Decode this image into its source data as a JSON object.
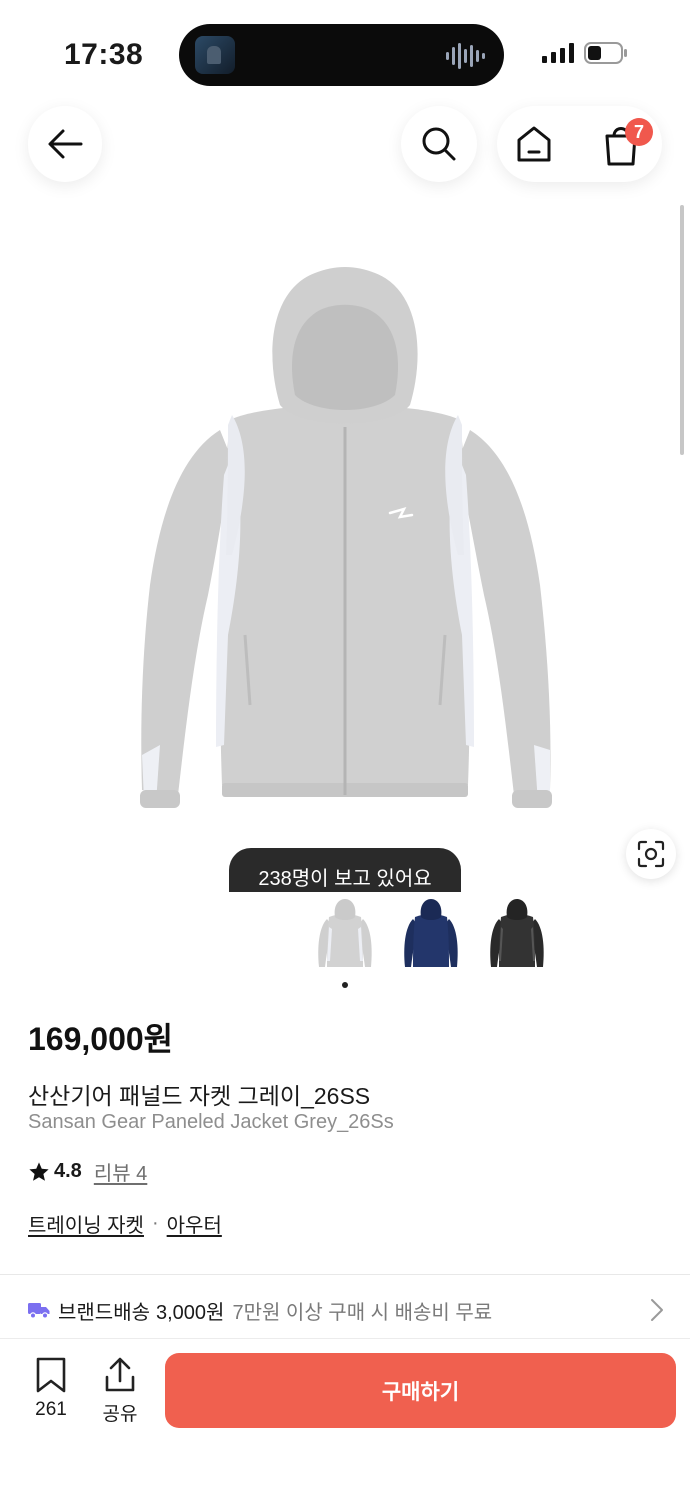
{
  "status_bar": {
    "time": "17:38",
    "signal_icon": "signal-bars-icon",
    "battery_icon": "battery-low-icon"
  },
  "nav": {
    "back_icon": "arrow-left-icon",
    "search_icon": "search-icon",
    "home_icon": "home-icon",
    "cart_icon": "shopping-bag-icon",
    "cart_count": "7"
  },
  "gallery": {
    "viewers_text": "238명이 보고 있어요",
    "visual_search_icon": "camera-scan-icon",
    "thumbnails": [
      "grey",
      "navy",
      "black"
    ],
    "active_index": 0
  },
  "product": {
    "price": "169,000원",
    "name_ko": "산산기어 패널드 자켓 그레이_26SS",
    "name_en": "Sansan Gear Paneled Jacket Grey_26Ss",
    "rating": "4.8",
    "review_label": "리뷰 4",
    "category_1": "트레이닝 자켓",
    "category_sep": "·",
    "category_2": "아우터"
  },
  "shipping": {
    "icon": "truck-icon",
    "label": "브랜드배송",
    "cost": "3,000원",
    "note": "7만원 이상 구매 시 배송비 무료"
  },
  "bottom_bar": {
    "save_count": "261",
    "share_label": "공유",
    "buy_label": "구매하기"
  },
  "colors": {
    "accent": "#f0604f",
    "badge": "#f0584d",
    "shipping_icon": "#7b6ff0"
  }
}
